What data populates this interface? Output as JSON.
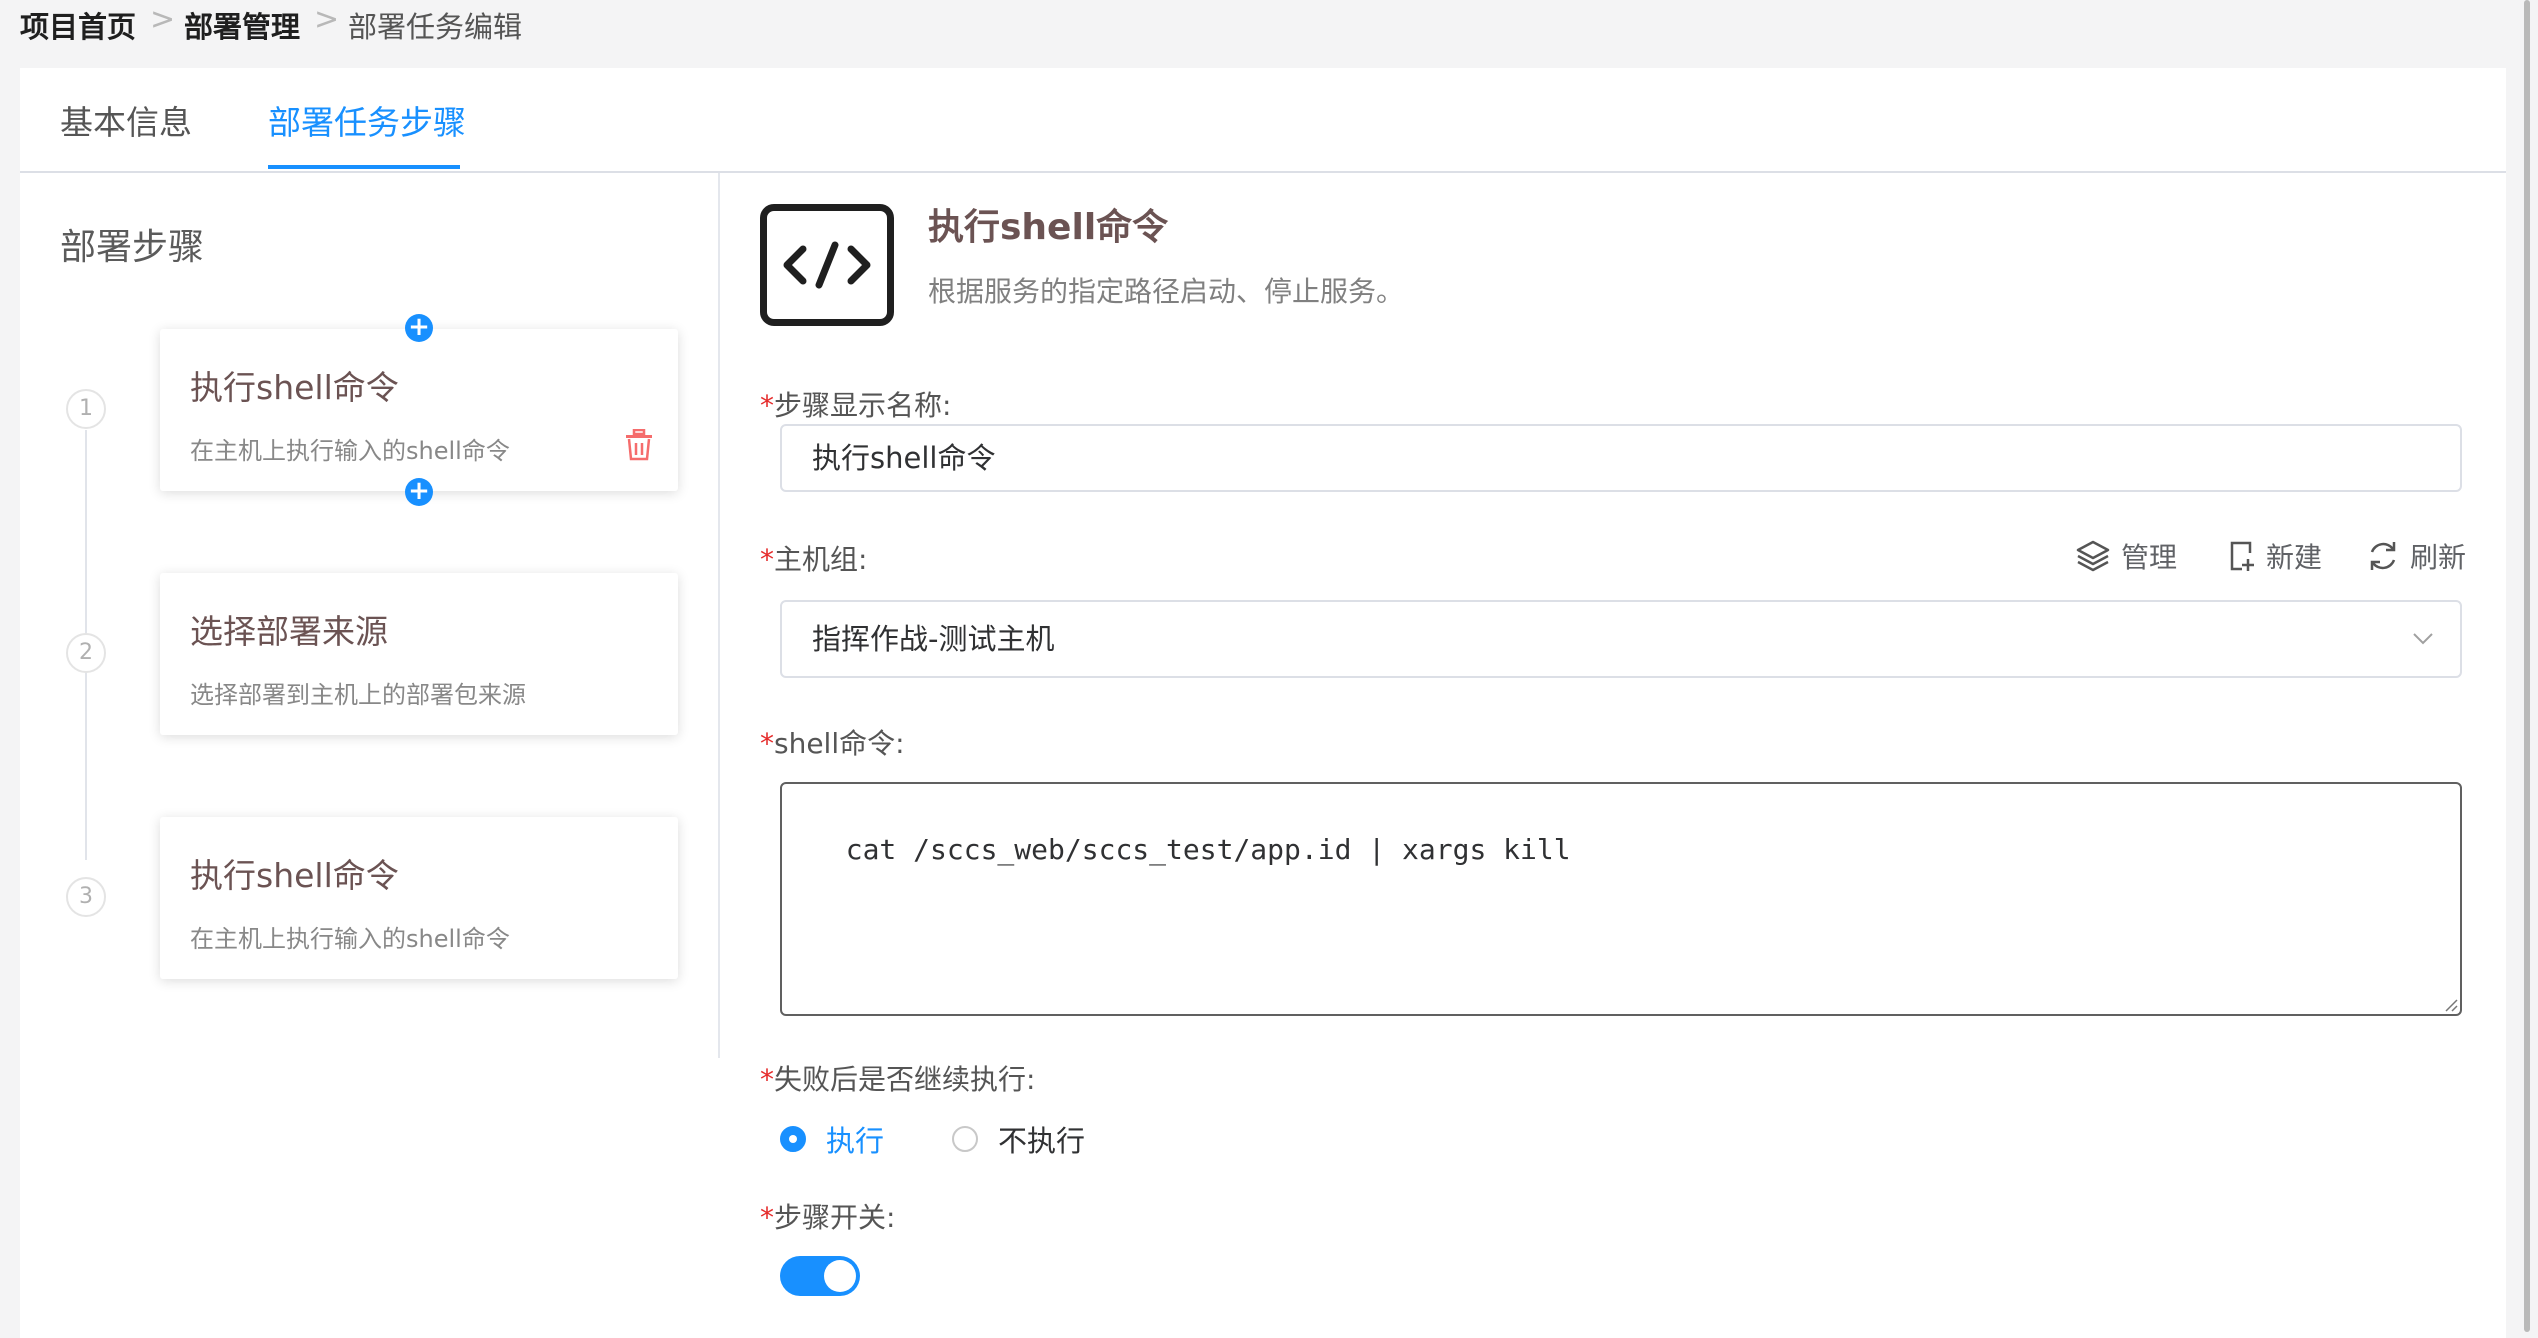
{
  "breadcrumb": {
    "items": [
      "项目首页",
      "部署管理",
      "部署任务编辑"
    ],
    "separator": ">"
  },
  "tabs": [
    {
      "label": "基本信息",
      "active": false
    },
    {
      "label": "部署任务步骤",
      "active": true
    }
  ],
  "sidebar": {
    "title": "部署步骤",
    "steps": [
      {
        "number": "1",
        "title": "执行shell命令",
        "desc": "在主机上执行输入的shell命令",
        "selected": true
      },
      {
        "number": "2",
        "title": "选择部署来源",
        "desc": "选择部署到主机上的部署包来源",
        "selected": false
      },
      {
        "number": "3",
        "title": "执行shell命令",
        "desc": "在主机上执行输入的shell命令",
        "selected": false
      }
    ],
    "add_icon": "+"
  },
  "detail": {
    "icon": "code-icon",
    "title": "执行shell命令",
    "desc": "根据服务的指定路径启动、停止服务。",
    "form": {
      "required_mark": "*",
      "name_label": "步骤显示名称:",
      "name_value": "执行shell命令",
      "hostgroup_label": "主机组:",
      "hostgroup_value": "指挥作战-测试主机",
      "hostgroup_tools": {
        "manage": "管理",
        "create": "新建",
        "refresh": "刷新"
      },
      "shell_label": "shell命令:",
      "shell_value": "cat /sccs_web/sccs_test/app.id | xargs kill",
      "continue_label": "失败后是否继续执行:",
      "continue_options": [
        "执行",
        "不执行"
      ],
      "continue_selected": "执行",
      "switch_label": "步骤开关:",
      "switch_on": true
    }
  },
  "colors": {
    "primary": "#1890ff",
    "required": "#e52b2b",
    "delete": "#f56c6c",
    "title": "#6b5353"
  }
}
